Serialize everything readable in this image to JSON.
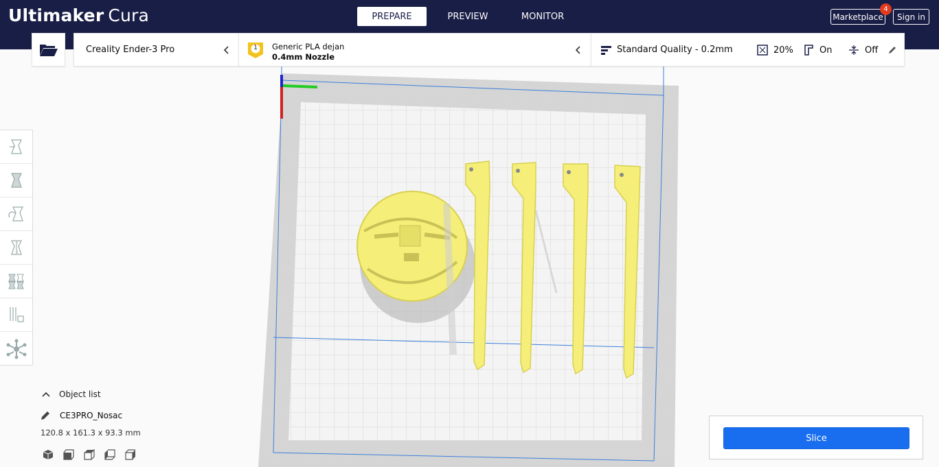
{
  "header": {
    "logo_brand": "Ultimaker",
    "logo_product": "Cura",
    "stages": [
      {
        "label": "PREPARE",
        "active": true
      },
      {
        "label": "PREVIEW",
        "active": false
      },
      {
        "label": "MONITOR",
        "active": false
      }
    ],
    "marketplace_label": "Marketplace",
    "marketplace_badge": "4",
    "signin_label": "Sign in"
  },
  "toolbar": {
    "open_icon": "folder-open-icon",
    "printer": "Creality Ender-3 Pro",
    "material_extruder": "1",
    "material_name": "Generic PLA dejan",
    "nozzle": "0.4mm Nozzle",
    "profile": "Standard Quality - 0.2mm",
    "infill": "20%",
    "support": "On",
    "adhesion": "Off"
  },
  "tools": [
    "move-tool-icon",
    "scale-tool-icon",
    "rotate-tool-icon",
    "mirror-tool-icon",
    "per-model-settings-icon",
    "support-blocker-icon",
    "tree-support-icon"
  ],
  "object_list": {
    "toggle_label": "Object list",
    "object_name": "CE3PRO_Nosac",
    "dimensions": "120.8 x 161.3 x 93.3 mm",
    "view_buttons": [
      "3d-view-icon",
      "front-view-icon",
      "top-view-icon",
      "left-view-icon",
      "right-view-icon"
    ]
  },
  "slice": {
    "label": "Slice"
  },
  "colors": {
    "header_bg": "#191e46",
    "accent_blue": "#196ef0",
    "model_yellow": "#f5ef7a",
    "badge_red": "#e13b1f"
  }
}
